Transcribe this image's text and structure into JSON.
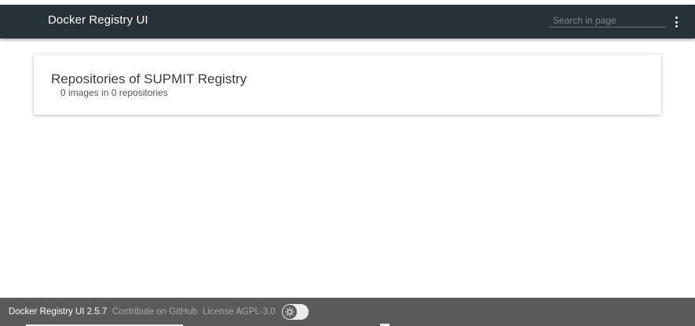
{
  "header": {
    "title": "Docker Registry UI",
    "search_placeholder": "Search in page",
    "search_value": "",
    "menu_icon": "more-vertical-icon"
  },
  "main": {
    "card_title": "Repositories of SUPMIT Registry",
    "card_subtitle": "0 images in 0 repositories"
  },
  "footer": {
    "version_label": "Docker Registry UI 2.5.7",
    "github_link": "Contribute on GitHub",
    "license_link": "License AGPL-3.0",
    "theme_toggle_icon": "sun-icon"
  },
  "colors": {
    "header_bg": "#263238",
    "footer_bg": "#5a5a5a"
  }
}
